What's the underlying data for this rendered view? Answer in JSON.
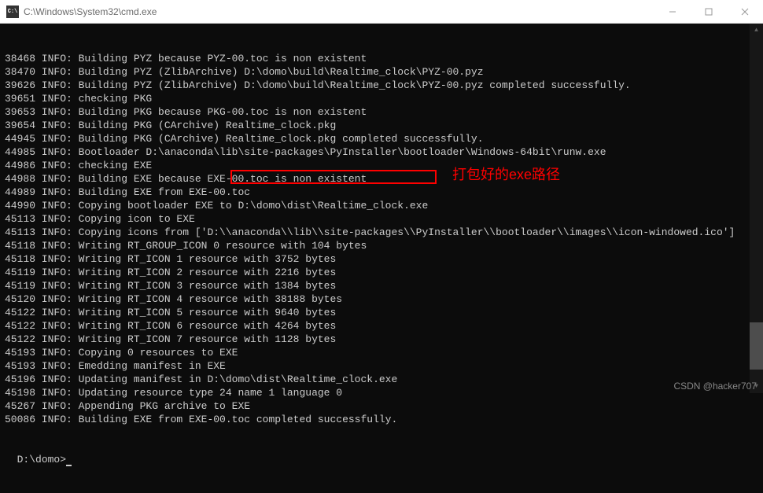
{
  "titlebar": {
    "icon_text": "C:\\",
    "title": "C:\\Windows\\System32\\cmd.exe"
  },
  "annotation": {
    "text": "打包好的exe路径"
  },
  "highlight": {
    "target_text": "D:\\domo\\dist\\Realtime_clock.exe"
  },
  "lines": [
    "38468 INFO: Building PYZ because PYZ-00.toc is non existent",
    "38470 INFO: Building PYZ (ZlibArchive) D:\\domo\\build\\Realtime_clock\\PYZ-00.pyz",
    "39626 INFO: Building PYZ (ZlibArchive) D:\\domo\\build\\Realtime_clock\\PYZ-00.pyz completed successfully.",
    "39651 INFO: checking PKG",
    "39653 INFO: Building PKG because PKG-00.toc is non existent",
    "39654 INFO: Building PKG (CArchive) Realtime_clock.pkg",
    "44945 INFO: Building PKG (CArchive) Realtime_clock.pkg completed successfully.",
    "44985 INFO: Bootloader D:\\anaconda\\lib\\site-packages\\PyInstaller\\bootloader\\Windows-64bit\\runw.exe",
    "44986 INFO: checking EXE",
    "44988 INFO: Building EXE because EXE-00.toc is non existent",
    "44989 INFO: Building EXE from EXE-00.toc",
    "44990 INFO: Copying bootloader EXE to D:\\domo\\dist\\Realtime_clock.exe",
    "45113 INFO: Copying icon to EXE",
    "45113 INFO: Copying icons from ['D:\\\\anaconda\\\\lib\\\\site-packages\\\\PyInstaller\\\\bootloader\\\\images\\\\icon-windowed.ico']",
    "45118 INFO: Writing RT_GROUP_ICON 0 resource with 104 bytes",
    "45118 INFO: Writing RT_ICON 1 resource with 3752 bytes",
    "45119 INFO: Writing RT_ICON 2 resource with 2216 bytes",
    "45119 INFO: Writing RT_ICON 3 resource with 1384 bytes",
    "45120 INFO: Writing RT_ICON 4 resource with 38188 bytes",
    "45122 INFO: Writing RT_ICON 5 resource with 9640 bytes",
    "45122 INFO: Writing RT_ICON 6 resource with 4264 bytes",
    "45122 INFO: Writing RT_ICON 7 resource with 1128 bytes",
    "45193 INFO: Copying 0 resources to EXE",
    "45193 INFO: Emedding manifest in EXE",
    "45196 INFO: Updating manifest in D:\\domo\\dist\\Realtime_clock.exe",
    "45198 INFO: Updating resource type 24 name 1 language 0",
    "45267 INFO: Appending PKG archive to EXE",
    "50086 INFO: Building EXE from EXE-00.toc completed successfully.",
    ""
  ],
  "prompt": "D:\\domo>",
  "watermark": "CSDN @hacker707"
}
